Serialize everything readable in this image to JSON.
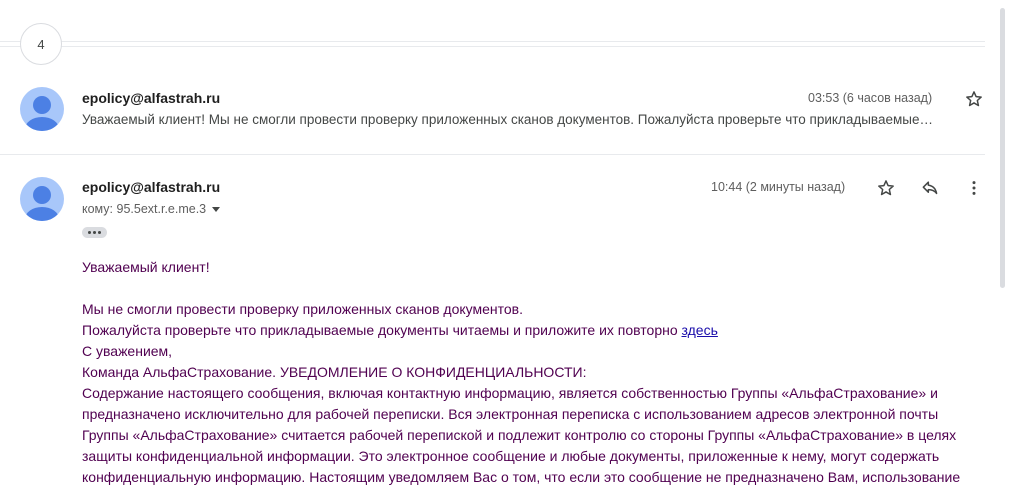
{
  "thread": {
    "collapsed_count": "4"
  },
  "messages": [
    {
      "sender": "epolicy@alfastrah.ru",
      "time": "03:53 (6 часов назад)",
      "snippet": "Уважаемый клиент! Мы не смогли провести проверку приложенных сканов документов. Пожалуйста проверьте что прикладываемые…"
    },
    {
      "sender": "epolicy@alfastrah.ru",
      "time": "10:44 (2 минуты назад)",
      "to": "кому: 95.5ext.r.e.me.3",
      "body": {
        "greeting": "Уважаемый клиент!",
        "line1": "Мы не смогли провести проверку приложенных сканов документов.",
        "line2_text": "Пожалуйста проверьте что прикладываемые документы читаемы и приложите их повторно ",
        "line2_link": "здесь",
        "regards": "С уважением,",
        "signature": "Команда АльфаСтрахование. УВЕДОМЛЕНИЕ О КОНФИДЕНЦИАЛЬНОСТИ:",
        "disclaimer": "Содержание настоящего сообщения, включая контактную информацию, является собственностью Группы «АльфаСтрахование» и предназначено исключительно для рабочей переписки. Вся электронная переписка с использованием адресов электронной почты Группы «АльфаСтрахование» считается рабочей перепиской и подлежит контролю со стороны Группы «АльфаСтрахование» в целях защиты конфиденциальной информации. Это электронное сообщение и любые документы, приложенные к нему, могут содержать конфиденциальную информацию. Настоящим уведомляем Вас о том, что если это сообщение не предназначено Вам, использование"
      }
    }
  ],
  "icons": {
    "star": "star-icon",
    "reply": "reply-icon",
    "more": "more-vert-icon",
    "avatar": "avatar-icon"
  }
}
